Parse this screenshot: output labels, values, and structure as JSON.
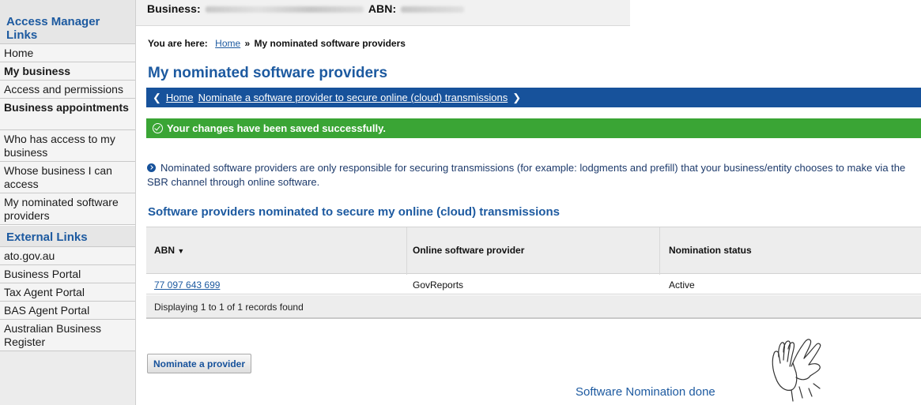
{
  "sidebar": {
    "header": "Access Manager Links",
    "items": [
      {
        "label": "Home",
        "bold": false
      },
      {
        "label": "My business",
        "bold": true
      },
      {
        "label": "Access and permissions",
        "bold": false
      },
      {
        "label": "Business appointments",
        "bold": true
      },
      {
        "label": "Who has access to my business",
        "bold": false
      },
      {
        "label": "Whose business I can access",
        "bold": false
      },
      {
        "label": "My nominated software providers",
        "bold": false
      }
    ],
    "external_header": "External Links",
    "external_items": [
      {
        "label": "ato.gov.au"
      },
      {
        "label": "Business Portal"
      },
      {
        "label": "Tax Agent Portal"
      },
      {
        "label": "BAS Agent Portal"
      },
      {
        "label": "Australian Business Register"
      }
    ]
  },
  "topbar": {
    "business_label": "Business:",
    "abn_label": "ABN:"
  },
  "breadcrumb": {
    "prefix": "You are here:",
    "home": "Home",
    "separator": "»",
    "current": "My nominated software providers"
  },
  "page_title": "My nominated software providers",
  "nav_bar": {
    "prev_icon": "chevron-left-icon",
    "home": "Home",
    "link": "Nominate a software provider to secure online (cloud) transmissions",
    "next_icon": "chevron-right-icon"
  },
  "success_message": "Your changes have been saved successfully.",
  "info_text": "Nominated software providers are only responsible for securing transmissions (for example: lodgments and prefill) that your business/entity chooses to make via the SBR channel through online software.",
  "section_title": "Software providers nominated to secure my online (cloud) transmissions",
  "table": {
    "columns": [
      "ABN",
      "Online software provider",
      "Nomination status"
    ],
    "sort_indicator": "▼",
    "rows": [
      {
        "abn": "77 097 643 699",
        "provider": "GovReports",
        "status": "Active"
      }
    ],
    "footer": "Displaying 1 to 1 of 1 records found"
  },
  "nominate_button": "Nominate a provider",
  "done_caption": "Software Nomination done",
  "colors": {
    "brand_blue": "#17529b",
    "link_blue": "#1d5aa0",
    "success_green": "#3aa535"
  }
}
